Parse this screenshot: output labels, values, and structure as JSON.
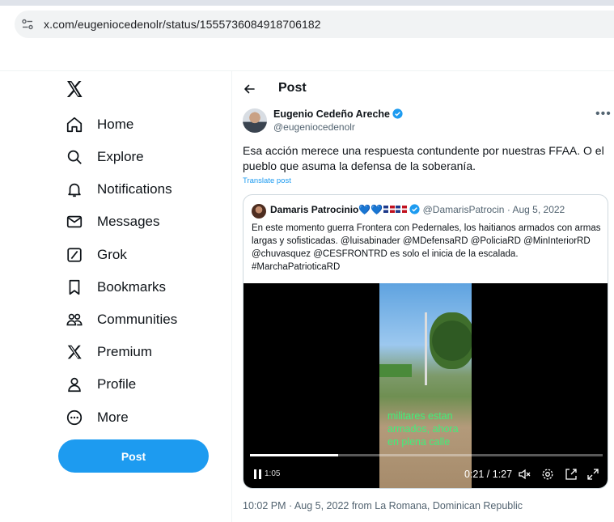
{
  "browser": {
    "url": "x.com/eugeniocedenolr/status/1555736084918706182"
  },
  "sidebar": {
    "items": [
      {
        "label": "Home",
        "icon": "home-icon"
      },
      {
        "label": "Explore",
        "icon": "search-icon"
      },
      {
        "label": "Notifications",
        "icon": "bell-icon"
      },
      {
        "label": "Messages",
        "icon": "envelope-icon"
      },
      {
        "label": "Grok",
        "icon": "grok-icon"
      },
      {
        "label": "Bookmarks",
        "icon": "bookmark-icon"
      },
      {
        "label": "Communities",
        "icon": "communities-icon"
      },
      {
        "label": "Premium",
        "icon": "x-logo-icon"
      },
      {
        "label": "Profile",
        "icon": "person-icon"
      },
      {
        "label": "More",
        "icon": "more-circle-icon"
      }
    ],
    "post_button": "Post"
  },
  "header": {
    "title": "Post"
  },
  "tweet": {
    "author_name": "Eugenio Cedeño Areche",
    "author_handle": "@eugeniocedenolr",
    "text": "Esa acción merece una respuesta contundente por nuestras FFAA. O el pueblo que asuma la defensa de la soberanía.",
    "translate": "Translate post",
    "timestamp": "10:02 PM · Aug 5, 2022 from La Romana, Dominican Republic"
  },
  "quote": {
    "author_name": "Damaris Patrocinio💙💙",
    "handle": "@DamarisPatrocin",
    "separator": " · ",
    "date": "Aug 5, 2022",
    "text": "En este momento guerra Frontera con Pedernales, los haitianos armados con armas largas y sofisticadas. @luisabinader @MDefensaRD @PoliciaRD @MinInteriorRD @chuvasquez @CESFRONTRD es solo el inicia de la escalada. #MarchaPatrioticaRD"
  },
  "video": {
    "overlay_text": "militares estan armados, ahora en plena calle",
    "current_time": "1:05",
    "duration": "0:21 / 1:27",
    "progress_fraction": 0.25
  },
  "colors": {
    "accent": "#1d9bf0",
    "text_primary": "#0f1419",
    "text_secondary": "#536471",
    "border": "#cfd9de"
  }
}
